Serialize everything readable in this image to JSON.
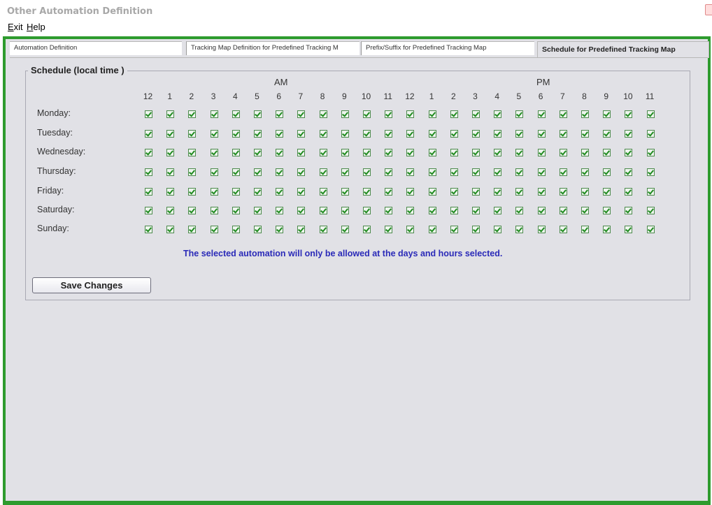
{
  "window": {
    "title": "Other Automation Definition"
  },
  "menu": {
    "exit": {
      "mnemonic": "E",
      "rest": "xit"
    },
    "help": {
      "mnemonic": "H",
      "rest": "elp"
    }
  },
  "tabs": [
    {
      "label": "Automation Definition",
      "active": false
    },
    {
      "label": "Tracking Map Definition for Predefined Tracking M",
      "active": false
    },
    {
      "label": "Prefix/Suffix for Predefined Tracking Map",
      "active": false
    },
    {
      "label": "Schedule for Predefined Tracking Map",
      "active": true
    }
  ],
  "schedule": {
    "legend": "Schedule (local time )",
    "am_label": "AM",
    "pm_label": "PM",
    "hours": [
      "12",
      "1",
      "2",
      "3",
      "4",
      "5",
      "6",
      "7",
      "8",
      "9",
      "10",
      "11",
      "12",
      "1",
      "2",
      "3",
      "4",
      "5",
      "6",
      "7",
      "8",
      "9",
      "10",
      "11"
    ],
    "days": [
      "Monday:",
      "Tuesday:",
      "Wednesday:",
      "Thursday:",
      "Friday:",
      "Saturday:",
      "Sunday:"
    ],
    "all_checked": true
  },
  "note": "The selected automation will only be allowed at the days and hours selected.",
  "save_button": "Save Changes",
  "colors": {
    "frame_green": "#2e9b2e",
    "note_blue": "#2a2ab8",
    "panel_bg": "#e1e1e6"
  }
}
